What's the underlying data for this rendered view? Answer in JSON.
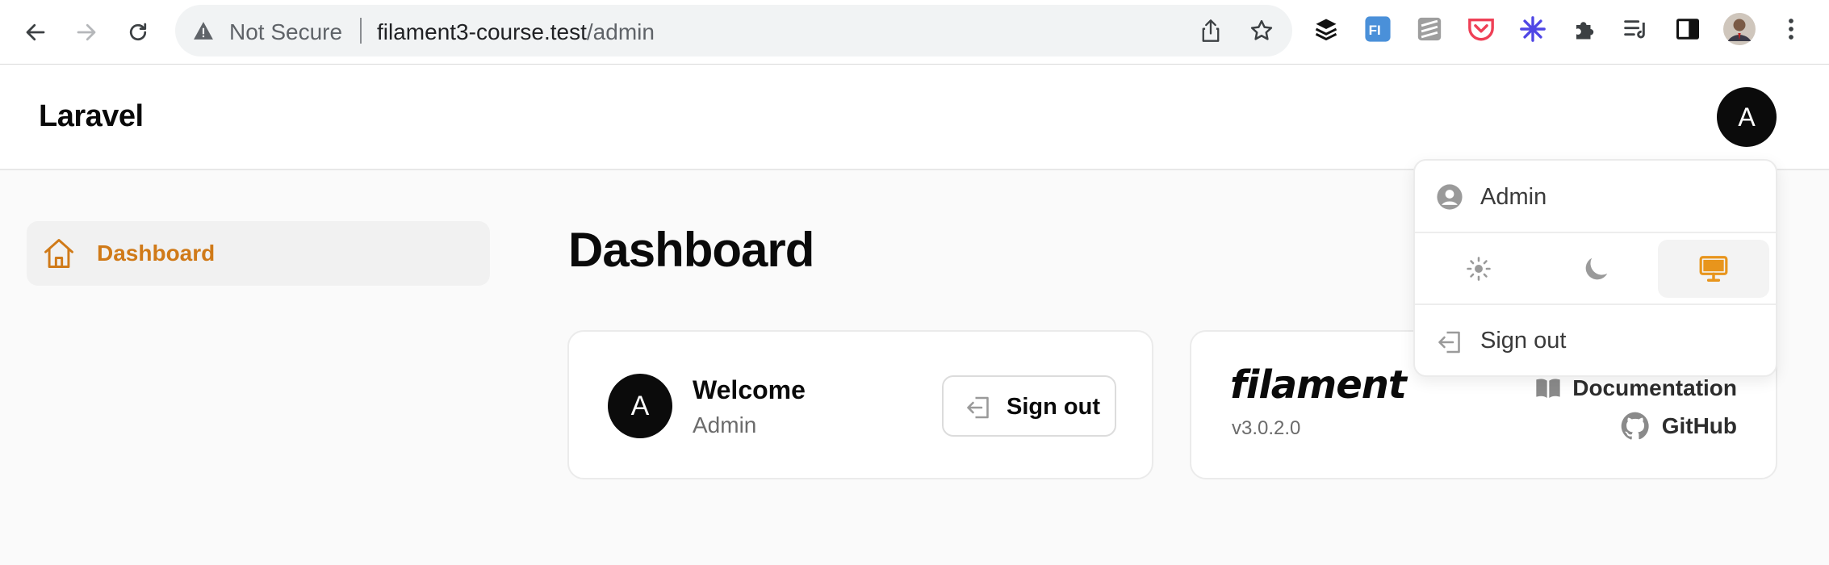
{
  "browser": {
    "security_label": "Not Secure",
    "url_host": "filament3-course.test",
    "url_path": "/admin"
  },
  "app": {
    "brand": "Laravel",
    "user_initial": "A"
  },
  "sidebar": {
    "items": [
      {
        "label": "Dashboard",
        "icon": "home-icon",
        "active": true
      }
    ]
  },
  "main": {
    "title": "Dashboard",
    "welcome_card": {
      "avatar_initial": "A",
      "title": "Welcome",
      "subtitle": "Admin",
      "button_label": "Sign out"
    },
    "filament_card": {
      "logo": "filament",
      "version": "v3.0.2.0",
      "links": [
        {
          "label": "Documentation",
          "icon": "book-icon"
        },
        {
          "label": "GitHub",
          "icon": "github-icon"
        }
      ]
    }
  },
  "user_menu": {
    "user_label": "Admin",
    "themes": [
      {
        "name": "light",
        "icon": "sun-icon"
      },
      {
        "name": "dark",
        "icon": "moon-icon"
      },
      {
        "name": "system",
        "icon": "monitor-icon",
        "active": true
      }
    ],
    "signout_label": "Sign out"
  },
  "colors": {
    "accent": "#d07a18",
    "avatar_bg": "#0b0b0b"
  }
}
